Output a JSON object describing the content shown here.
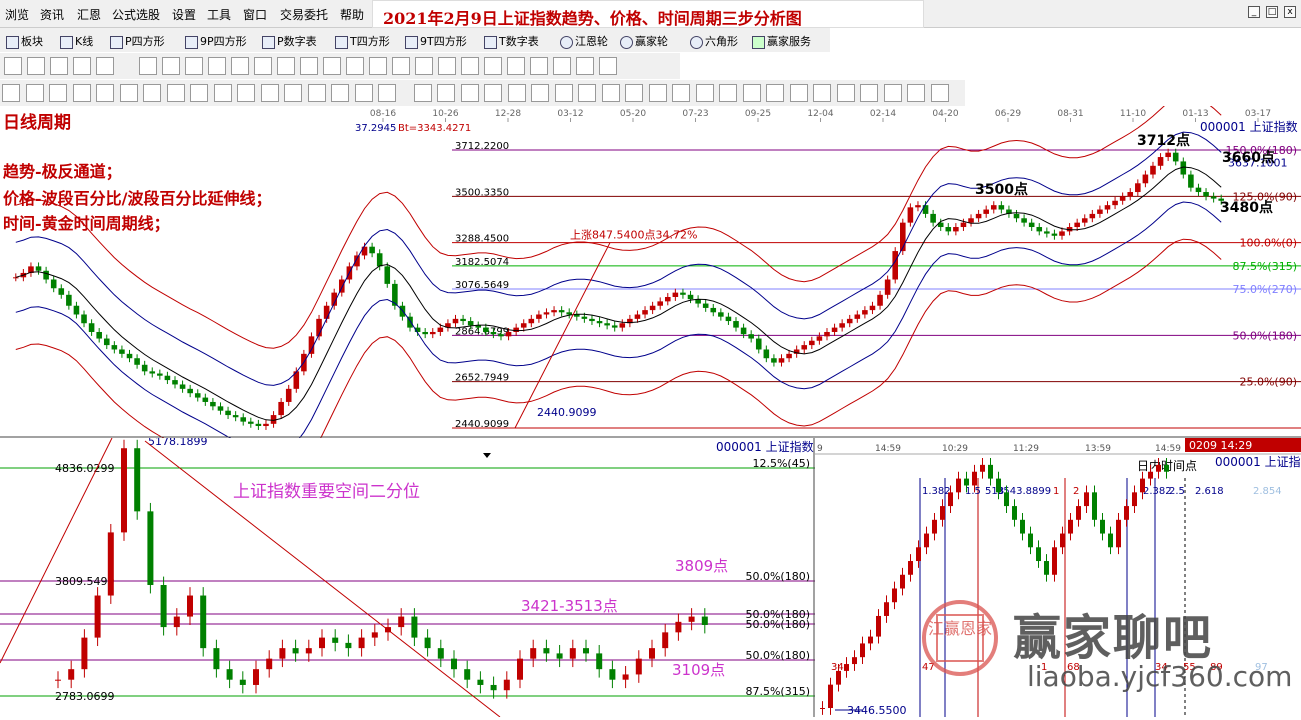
{
  "menu": [
    "浏览",
    "资讯",
    "汇恩",
    "公式选股",
    "设置",
    "工具",
    "窗口",
    "交易委托",
    "帮助"
  ],
  "title": "2021年2月9日上证指数趋势、价格、时间周期三步分析图",
  "window_controls": [
    "_",
    "□",
    "x"
  ],
  "toolbar1": [
    "板块",
    "K线",
    "P四方形",
    "9P四方形",
    "P数字表",
    "T四方形",
    "9T四方形",
    "T数字表",
    "江恩轮",
    "赢家轮",
    "六角形",
    "赢家服务"
  ],
  "date_axis": [
    "08-16",
    "10-26",
    "12-28",
    "03-12",
    "05-20",
    "07-23",
    "09-25",
    "12-04",
    "02-14",
    "04-20",
    "06-29",
    "08-31",
    "11-10",
    "01-13",
    "03-17"
  ],
  "main_chart": {
    "period_label": "日线周期",
    "notes": [
      "趋势-极反通道；",
      "价格-波段百分比/波段百分比延伸线；",
      "时间-黄金时间周期线；"
    ],
    "top_left_readout": "37.2945",
    "bt_readout": "Bt=3343.4271",
    "code_label": "000001  上证指数",
    "price_levels": [
      {
        "value": "3712.2200",
        "pct": "150.0%(180)",
        "color": "#800080"
      },
      {
        "value": "3500.3350",
        "pct": "125.0%(90)",
        "color": "#800000"
      },
      {
        "value": "3288.4500",
        "pct": "100.0%(0)",
        "color": "#c00000"
      },
      {
        "value": "3182.5074",
        "pct": "87.5%(315)",
        "color": "#00b000"
      },
      {
        "value": "3076.5649",
        "pct": "75.0%(270)",
        "color": "#8080ff"
      },
      {
        "value": "2864.6799",
        "pct": "50.0%(180)",
        "color": "#800080"
      },
      {
        "value": "2652.7949",
        "pct": "25.0%(90)",
        "color": "#800000"
      },
      {
        "value": "2440.9099",
        "pct": "",
        "color": "#c00000"
      }
    ],
    "upswing_label": "上涨847.5400点34.72%",
    "label_2440": "2440.9099",
    "level_3637": "3637.1001",
    "points": [
      {
        "text": "3712点"
      },
      {
        "text": "3660点"
      },
      {
        "text": "3500点"
      },
      {
        "text": "3480点"
      }
    ],
    "candles_closes": [
      3130,
      3150,
      3180,
      3160,
      3120,
      3080,
      3050,
      3000,
      2960,
      2920,
      2880,
      2850,
      2820,
      2800,
      2780,
      2760,
      2730,
      2700,
      2690,
      2680,
      2660,
      2640,
      2620,
      2600,
      2580,
      2560,
      2540,
      2520,
      2500,
      2490,
      2470,
      2460,
      2450,
      2460,
      2500,
      2560,
      2620,
      2700,
      2780,
      2860,
      2940,
      3000,
      3060,
      3120,
      3180,
      3230,
      3270,
      3240,
      3180,
      3100,
      3000,
      2950,
      2900,
      2880,
      2870,
      2880,
      2900,
      2920,
      2940,
      2930,
      2910,
      2900,
      2880,
      2870,
      2860,
      2880,
      2900,
      2920,
      2940,
      2960,
      2970,
      2980,
      2970,
      2960,
      2950,
      2940,
      2930,
      2920,
      2910,
      2900,
      2920,
      2940,
      2960,
      2980,
      3000,
      3020,
      3040,
      3060,
      3050,
      3030,
      3010,
      2990,
      2970,
      2950,
      2930,
      2900,
      2870,
      2850,
      2800,
      2760,
      2740,
      2760,
      2780,
      2800,
      2820,
      2840,
      2860,
      2880,
      2900,
      2920,
      2940,
      2960,
      2980,
      3000,
      3050,
      3120,
      3250,
      3380,
      3450,
      3460,
      3420,
      3380,
      3360,
      3340,
      3360,
      3380,
      3400,
      3420,
      3440,
      3460,
      3440,
      3420,
      3400,
      3380,
      3360,
      3340,
      3330,
      3320,
      3340,
      3360,
      3380,
      3400,
      3420,
      3440,
      3460,
      3480,
      3500,
      3520,
      3560,
      3600,
      3640,
      3680,
      3700,
      3660,
      3600,
      3540,
      3520,
      3500,
      3490,
      3480
    ]
  },
  "sub_chart1": {
    "code_label": "000001  上证指数",
    "title": "上证指数重要空间二分位",
    "top_value": "5178.1899",
    "levels": [
      {
        "value": "4836.0299",
        "pct": "12.5%(45)",
        "color": "#00a000"
      },
      {
        "value": "3809.5499",
        "pct": "50.0%(180)",
        "color": "#800080"
      },
      {
        "value": "",
        "pct": "50.0%(180)",
        "color": "#800080"
      },
      {
        "value": "",
        "pct": "50.0%(180)",
        "color": "#800080"
      },
      {
        "value": "",
        "pct": "50.0%(180)",
        "color": "#800080"
      },
      {
        "value": "2783.0699",
        "pct": "87.5%(315)",
        "color": "#00a000"
      }
    ],
    "labels": [
      "3809点",
      "3421-3513点",
      "3109点"
    ]
  },
  "sub_chart2": {
    "time_badge": "0209 14:29",
    "code_label": "000001  上证指",
    "subtitle": "日内时间点",
    "time_axis": [
      "9",
      "14:59",
      "10:29",
      "11:29",
      "13:59",
      "14:59"
    ],
    "readings": [
      "1.382",
      "1.5",
      "518",
      "3543.8899",
      "1",
      "2",
      "2.382",
      "2.5",
      "2.618",
      "2.854"
    ],
    "bottom_counts": [
      "34",
      "47",
      "1",
      "68",
      "34",
      "55",
      "89",
      "97"
    ],
    "low_value": "3446.5500"
  },
  "watermark": {
    "text": "赢家聊吧",
    "url": "liaoba.yjcf360.com",
    "seal": "江赢恩家"
  },
  "colors": {
    "accent_red": "#c00000",
    "bg": "#ffffff",
    "toolbar": "#f0f0f0"
  }
}
